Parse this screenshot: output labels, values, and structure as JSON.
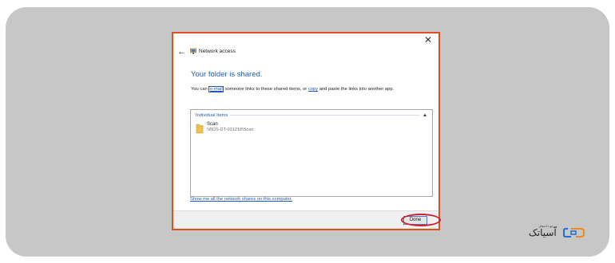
{
  "dialog": {
    "close_glyph": "✕",
    "back_glyph": "←",
    "title": "Network access",
    "heading": "Your folder is shared.",
    "description": {
      "prefix": "You can ",
      "email_link": "e-mail",
      "middle": " someone links to these shared items, or ",
      "copy_link": "copy",
      "suffix": " and paste the links into another app."
    },
    "group": {
      "label": "Individual Items",
      "chevron": "▲"
    },
    "items": [
      {
        "name": "Scan",
        "path": "\\\\BDS-DT-031218\\Scan"
      }
    ],
    "show_link": "Show me all the network shares on this computer.",
    "done_label": "Done"
  },
  "logo": {
    "tiny_text": "مرجع داده‌های",
    "text": "آسیاتک"
  },
  "colors": {
    "dialog_border": "#e0501f",
    "highlight": "#cf2032",
    "link": "#1f5cb7",
    "frame": "#c7c7c8"
  }
}
